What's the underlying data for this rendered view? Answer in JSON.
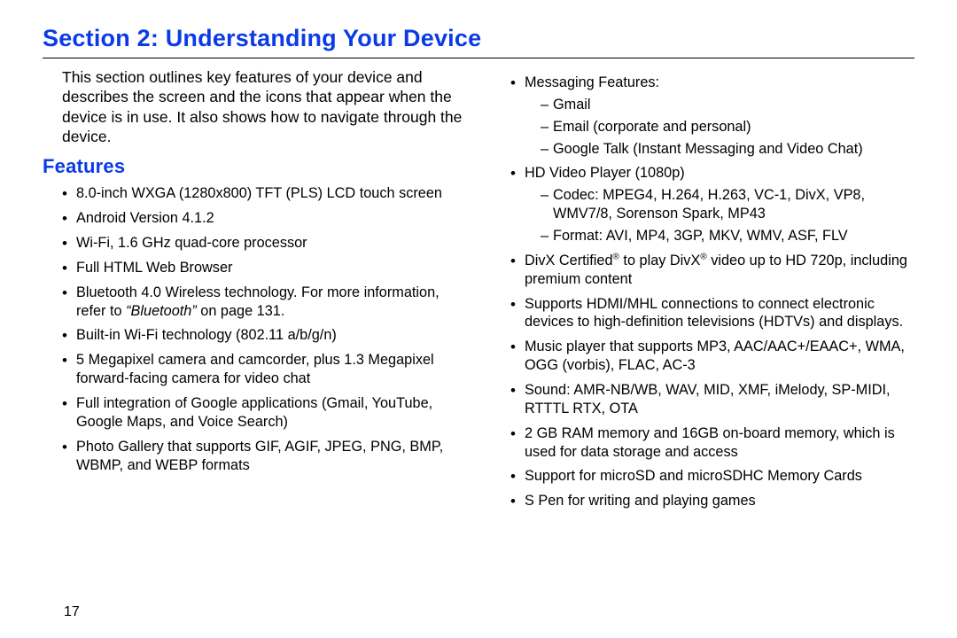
{
  "title": "Section 2: Understanding Your Device",
  "intro": "This section outlines key features of your device and describes the screen and the icons that appear when the device is in use. It also shows how to navigate through the device.",
  "features_heading": "Features",
  "page_number": "17",
  "bt40": "4.0",
  "reg_mark": "®",
  "bluetooth_ref_ital": "“Bluetooth”",
  "left": {
    "b1": "8.0-inch WXGA (1280x800) TFT (PLS) LCD touch screen",
    "b2": "Android Version 4.1.2",
    "b3": "Wi-Fi, 1.6 GHz quad-core processor",
    "b4": "Full HTML Web Browser",
    "b5a": "Bluetooth ",
    "b5b": " Wireless technology. For more information, refer to ",
    "b5c": " on page 131.",
    "b6": "Built-in Wi-Fi technology (802.11 a/b/g/n)",
    "b7": "5 Megapixel camera and camcorder, plus 1.3 Megapixel forward-facing camera for video chat",
    "b8": "Full integration of Google applications (Gmail, YouTube, Google Maps, and Voice Search)",
    "b9": "Photo Gallery that supports GIF, AGIF, JPEG, PNG, BMP, WBMP, and WEBP formats"
  },
  "right": {
    "msg_head": "Messaging Features:",
    "msg1": "Gmail",
    "msg2": "Email (corporate and personal)",
    "msg3": "Google Talk (Instant Messaging and Video Chat)",
    "hd_head": "HD Video Player (1080p)",
    "hd1": "Codec: MPEG4, H.264, H.263, VC-1, DivX, VP8, WMV7/8, Sorenson Spark, MP43",
    "hd2": "Format: AVI, MP4, 3GP, MKV, WMV, ASF, FLV",
    "divx_a": "DivX Certified",
    "divx_b": " to play DivX",
    "divx_c": " video up to HD 720p, including premium content",
    "hdmi": "Supports HDMI/MHL connections to connect electronic devices to high-definition televisions (HDTVs) and displays.",
    "music": "Music player that supports MP3, AAC/AAC+/EAAC+, WMA, OGG (vorbis), FLAC, AC-3",
    "sound": "Sound: AMR-NB/WB, WAV, MID, XMF, iMelody, SP-MIDI, RTTTL RTX, OTA",
    "ram": "2 GB RAM memory and 16GB on-board memory, which is used for data storage and access",
    "microsd": "Support for microSD and microSDHC Memory Cards",
    "spen": "S Pen for writing and playing games"
  }
}
